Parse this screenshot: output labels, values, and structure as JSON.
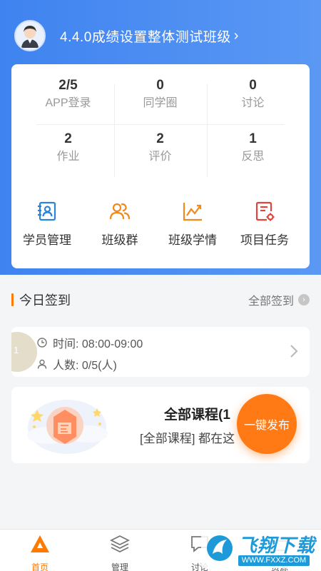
{
  "header": {
    "class_name": "4.4.0成绩设置整体测试班级",
    "chevron": "›"
  },
  "stats": [
    {
      "value": "2/5",
      "label": "APP登录"
    },
    {
      "value": "0",
      "label": "同学圈"
    },
    {
      "value": "0",
      "label": "讨论"
    },
    {
      "value": "2",
      "label": "作业"
    },
    {
      "value": "2",
      "label": "评价"
    },
    {
      "value": "1",
      "label": "反思"
    }
  ],
  "quick_actions": [
    {
      "label": "学员管理",
      "icon": "student-card-icon"
    },
    {
      "label": "班级群",
      "icon": "group-icon"
    },
    {
      "label": "班级学情",
      "icon": "chart-line-icon"
    },
    {
      "label": "项目任务",
      "icon": "task-settings-icon"
    }
  ],
  "signin": {
    "section_title": "今日签到",
    "all_link": "全部签到",
    "badge": "1",
    "time_text": "时间: 08:00-09:00",
    "count_text": "人数: 0/5(人)"
  },
  "course": {
    "title": "全部课程(1",
    "subtitle": "[全部课程] 都在这"
  },
  "fab": {
    "label": "一键发布"
  },
  "tabs": [
    {
      "label": "首页",
      "icon": "home-icon",
      "active": true
    },
    {
      "label": "管理",
      "icon": "layers-icon",
      "active": false
    },
    {
      "label": "讨论",
      "icon": "chat-icon",
      "active": false
    },
    {
      "label": "资源",
      "icon": "resource-icon",
      "active": false
    }
  ],
  "watermark": {
    "brand": "飞翔下载",
    "url": "WWW.FXXZ.COM"
  },
  "colors": {
    "primary_blue": "#4a8cf1",
    "accent_orange": "#ff7a00",
    "background": "#f4f5f7"
  }
}
